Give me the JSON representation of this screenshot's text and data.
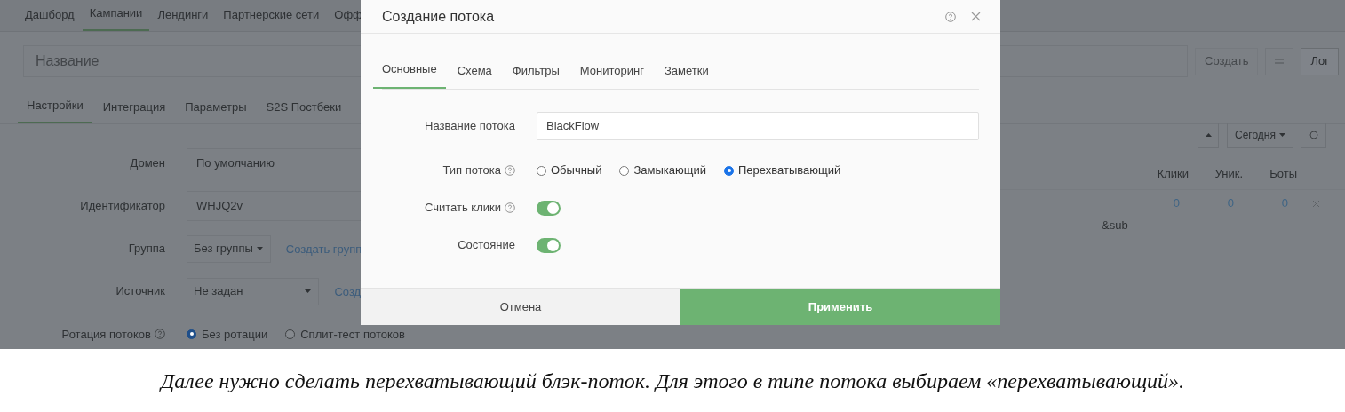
{
  "top_nav": [
    {
      "label": "Дашборд",
      "selected": false
    },
    {
      "label": "Кампании",
      "selected": true
    },
    {
      "label": "Лендинги",
      "selected": false
    },
    {
      "label": "Партнерские сети",
      "selected": false
    },
    {
      "label": "Офф",
      "selected": false
    }
  ],
  "campaign_name": {
    "placeholder": "Название"
  },
  "header_buttons": [
    {
      "kind": "text",
      "label": "Создать",
      "disabled": true
    },
    {
      "kind": "menu"
    },
    {
      "kind": "text",
      "label": "Лог",
      "disabled": false
    }
  ],
  "sub_tabs": [
    {
      "label": "Настройки",
      "selected": true
    },
    {
      "label": "Интеграция",
      "selected": false
    },
    {
      "label": "Параметры",
      "selected": false
    },
    {
      "label": "S2S Постбеки",
      "selected": false
    }
  ],
  "form": [
    {
      "kind": "text",
      "label": "Домен",
      "value": "По умолчанию"
    },
    {
      "kind": "text",
      "label": "Идентификатор",
      "value": "WHJQ2v"
    },
    {
      "kind": "select",
      "label": "Группа",
      "value": "Без группы",
      "link": "Создать групп"
    },
    {
      "kind": "select_wide",
      "label": "Источник",
      "value": "Не задан",
      "link": "Созд"
    },
    {
      "kind": "radio",
      "label": "Ротация потоков",
      "help": true,
      "options": [
        {
          "label": "Без ротации",
          "selected": true
        },
        {
          "label": "Сплит-тест потоков",
          "selected": false
        }
      ]
    }
  ],
  "stats": {
    "period": "Сегодня",
    "columns": [
      "Клики",
      "Уник.",
      "Боты"
    ],
    "rows": [
      {
        "values": [
          "0",
          "0",
          "0"
        ],
        "note": "&sub"
      }
    ]
  },
  "modal": {
    "title": "Создание потока",
    "tabs": [
      {
        "label": "Основные",
        "selected": true
      },
      {
        "label": "Схема",
        "selected": false
      },
      {
        "label": "Фильтры",
        "selected": false
      },
      {
        "label": "Мониторинг",
        "selected": false
      },
      {
        "label": "Заметки",
        "selected": false
      }
    ],
    "fields": [
      {
        "kind": "text",
        "label": "Название потока",
        "value": "BlackFlow"
      },
      {
        "kind": "radio",
        "label": "Тип потока",
        "help": true,
        "options": [
          {
            "label": "Обычный",
            "selected": false
          },
          {
            "label": "Замыкающий",
            "selected": false
          },
          {
            "label": "Перехватывающий",
            "selected": true
          }
        ]
      },
      {
        "kind": "toggle",
        "label": "Считать клики",
        "help": true,
        "on": true
      },
      {
        "kind": "toggle",
        "label": "Состояние",
        "help": false,
        "on": true
      }
    ],
    "buttons": [
      {
        "kind": "secondary",
        "label": "Отмена"
      },
      {
        "kind": "primary",
        "label": "Применить"
      }
    ]
  },
  "caption": "Далее нужно сделать перехватывающий блэк-поток. Для этого в типе потока выбираем «перехватывающий»."
}
